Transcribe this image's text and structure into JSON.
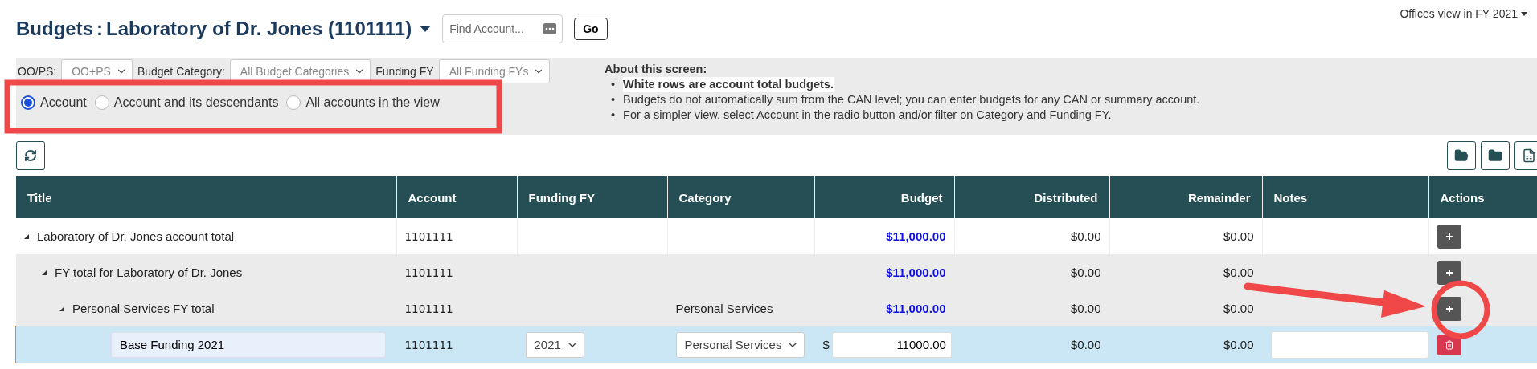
{
  "header": {
    "title": "Budgets",
    "separator": ":",
    "account": "Laboratory of Dr. Jones (1101111)",
    "find": {
      "placeholder": "Find Account..."
    },
    "go_button": "Go",
    "view_menu": "Offices view in FY 2021"
  },
  "filters": [
    {
      "label": "OO/PS:",
      "value": "OO+PS"
    },
    {
      "label": "Budget Category:",
      "value": "All Budget Categories"
    },
    {
      "label": "Funding FY",
      "value": "All Funding FYs"
    }
  ],
  "scope": [
    {
      "label": "Account",
      "selected": true
    },
    {
      "label": "Account and its descendants",
      "selected": false
    },
    {
      "label": "All accounts in the view",
      "selected": false
    }
  ],
  "about": {
    "heading": "About this screen:",
    "bullets": [
      {
        "marker": "•",
        "text": "White rows are account total budgets.",
        "bold": true
      },
      {
        "marker": "•",
        "text": "Budgets do not automatically sum from the CAN level; you can enter budgets for any CAN or summary account.",
        "bold": false
      },
      {
        "marker": "•",
        "text": "For a simpler view, select Account in the radio button and/or filter on Category and Funding FY.",
        "bold": false
      }
    ]
  },
  "table": {
    "columns": [
      "Title",
      "Account",
      "Funding FY",
      "Category",
      "Budget",
      "Distributed",
      "Remainder",
      "Notes",
      "Actions"
    ],
    "rows": [
      {
        "kind": "total",
        "title": "Laboratory of Dr. Jones account total",
        "expanded": true,
        "account": "1101111",
        "budget": "$11,000.00",
        "distributed": "$0.00",
        "remainder": "$0.00",
        "children": [
          {
            "kind": "subtotal",
            "title": "FY total for Laboratory of Dr. Jones",
            "expanded": true,
            "account": "1101111",
            "budget": "$11,000.00",
            "distributed": "$0.00",
            "remainder": "$0.00",
            "children": [
              {
                "kind": "subtotal",
                "title": "Personal Services FY total",
                "expanded": true,
                "account": "1101111",
                "category": "Personal Services",
                "budget": "$11,000.00",
                "distributed": "$0.00",
                "remainder": "$0.00",
                "children": [
                  {
                    "kind": "entry",
                    "title": "Base Funding 2021",
                    "account": "1101111",
                    "funding_fy": "2021",
                    "category": "Personal Services",
                    "currency": "$",
                    "budget": "11000.00",
                    "distributed": "$0.00",
                    "remainder": "$0.00"
                  }
                ]
              }
            ]
          }
        ]
      }
    ]
  },
  "annotations": [
    {
      "kind": "box"
    },
    {
      "kind": "arrow"
    },
    {
      "kind": "circle"
    }
  ]
}
